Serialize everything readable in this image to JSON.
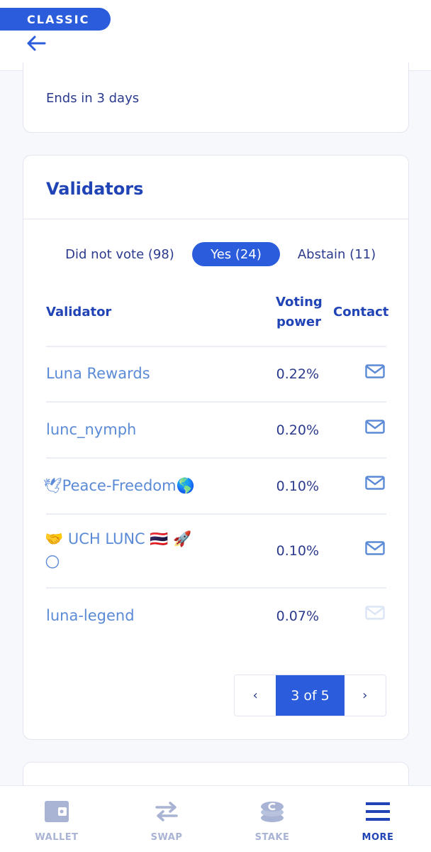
{
  "header": {
    "badge": "CLASSIC",
    "back_icon": "arrow-left-icon"
  },
  "proposal": {
    "ends_text": "Ends in 3 days"
  },
  "validators_card": {
    "title": "Validators",
    "tabs": [
      {
        "label": "Did not vote (98)",
        "active": false
      },
      {
        "label": "Yes (24)",
        "active": true
      },
      {
        "label": "Abstain (11)",
        "active": false
      }
    ],
    "columns": {
      "validator": "Validator",
      "voting_power_line1": "Voting",
      "voting_power_line2": "power",
      "contact": "Contact"
    },
    "rows": [
      {
        "name": "Luna Rewards",
        "power": "0.22%",
        "contact_icon": "mail-icon",
        "contact_enabled": true
      },
      {
        "name": "lunc_nymph",
        "power": "0.20%",
        "contact_icon": "mail-icon",
        "contact_enabled": true
      },
      {
        "name": "🕊Peace-Freedom🌎",
        "power": "0.10%",
        "contact_icon": "mail-icon",
        "contact_enabled": true
      },
      {
        "name_line1": "🤝 UCH LUNC 🇹🇭 🚀",
        "name_line2": "🌕",
        "power": "0.10%",
        "contact_icon": "mail-icon",
        "contact_enabled": true
      },
      {
        "name": "luna-legend",
        "power": "0.07%",
        "contact_icon": "mail-icon",
        "contact_enabled": false
      }
    ],
    "pagination": {
      "prev": "‹",
      "current": "3 of 5",
      "next": "›"
    }
  },
  "bottom_nav": [
    {
      "label": "WALLET",
      "icon": "wallet-icon",
      "active": false
    },
    {
      "label": "SWAP",
      "icon": "swap-icon",
      "active": false
    },
    {
      "label": "STAKE",
      "icon": "stake-coins-icon",
      "active": false
    },
    {
      "label": "MORE",
      "icon": "menu-icon",
      "active": true
    }
  ],
  "colors": {
    "accent": "#2a5cdb",
    "text_dark": "#2043b5",
    "link": "#5b8ad6",
    "inactive_nav": "#a9b3d3"
  }
}
